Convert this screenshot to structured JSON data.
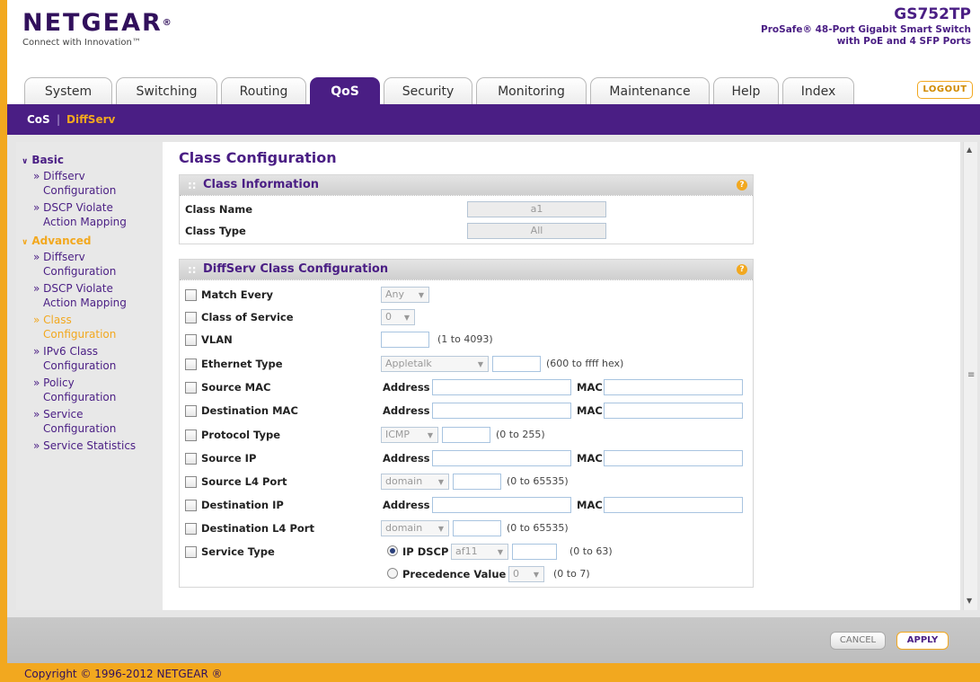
{
  "header": {
    "brand": "NETGEAR",
    "brand_mark": "®",
    "tagline": "Connect with Innovation™",
    "model": "GS752TP",
    "model_desc_1": "ProSafe® 48-Port Gigabit Smart Switch",
    "model_desc_2": "with PoE and 4 SFP Ports",
    "logout": "LOGOUT"
  },
  "tabs": [
    {
      "label": "System"
    },
    {
      "label": "Switching"
    },
    {
      "label": "Routing"
    },
    {
      "label": "QoS"
    },
    {
      "label": "Security"
    },
    {
      "label": "Monitoring"
    },
    {
      "label": "Maintenance"
    },
    {
      "label": "Help"
    },
    {
      "label": "Index"
    }
  ],
  "subnav": {
    "cos": "CoS",
    "sep": "|",
    "diffserv": "DiffServ"
  },
  "sidebar": {
    "basic": "Basic",
    "advanced": "Advanced",
    "basic_items": [
      {
        "l1": "» Diffserv",
        "l2": "Configuration"
      },
      {
        "l1": "» DSCP Violate",
        "l2": "Action Mapping"
      }
    ],
    "advanced_items": [
      {
        "l1": "» Diffserv",
        "l2": "Configuration"
      },
      {
        "l1": "» DSCP Violate",
        "l2": "Action Mapping"
      },
      {
        "l1": "» Class",
        "l2": "Configuration"
      },
      {
        "l1": "» IPv6 Class",
        "l2": "Configuration"
      },
      {
        "l1": "» Policy",
        "l2": "Configuration"
      },
      {
        "l1": "» Service",
        "l2": "Configuration"
      },
      {
        "l1": "» Service Statistics",
        "l2": ""
      }
    ]
  },
  "main": {
    "title": "Class Configuration",
    "class_info": {
      "header": "Class Information",
      "name_label": "Class Name",
      "name_value": "a1",
      "type_label": "Class Type",
      "type_value": "All"
    },
    "diffserv": {
      "header": "DiffServ Class Configuration",
      "match_every": "Match Every",
      "match_every_value": "Any",
      "cos": "Class of Service",
      "cos_value": "0",
      "vlan": "VLAN",
      "vlan_note": "(1 to 4093)",
      "eth_type": "Ethernet Type",
      "eth_type_value": "Appletalk",
      "eth_note": "(600 to ffff hex)",
      "src_mac": "Source MAC",
      "dst_mac": "Destination MAC",
      "address": "Address",
      "mac": "MAC",
      "protocol": "Protocol Type",
      "protocol_value": "ICMP",
      "protocol_note": "(0 to 255)",
      "src_ip": "Source IP",
      "src_l4": "Source L4 Port",
      "port_value": "domain",
      "port_note": "(0 to 65535)",
      "dst_ip": "Destination IP",
      "dst_l4": "Destination L4 Port",
      "service_type": "Service Type",
      "ip_dscp": "IP DSCP",
      "ip_dscp_value": "af11",
      "dscp_note": "(0 to 63)",
      "precedence": "Precedence Value",
      "precedence_value": "0",
      "precedence_note": "(0 to 7)"
    }
  },
  "footer": {
    "cancel": "CANCEL",
    "apply": "APPLY",
    "copyright": "Copyright © 1996-2012 NETGEAR ®"
  },
  "colors": {
    "purple": "#4a1e84",
    "orange": "#f2a81f"
  }
}
